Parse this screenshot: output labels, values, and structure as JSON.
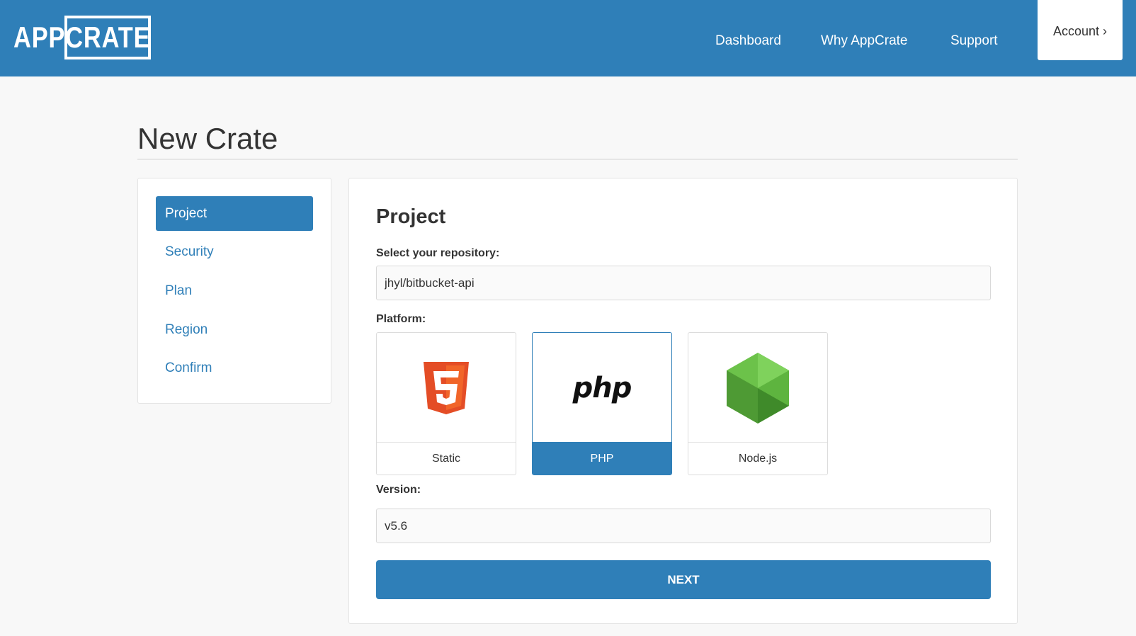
{
  "header": {
    "logo_left": "APP",
    "logo_right": "CRATE",
    "nav": [
      "Dashboard",
      "Why AppCrate",
      "Support"
    ],
    "account_label": "Account ›"
  },
  "page": {
    "title": "New Crate"
  },
  "sidebar": {
    "items": [
      {
        "label": "Project",
        "active": true
      },
      {
        "label": "Security",
        "active": false
      },
      {
        "label": "Plan",
        "active": false
      },
      {
        "label": "Region",
        "active": false
      },
      {
        "label": "Confirm",
        "active": false
      }
    ]
  },
  "form": {
    "section_title": "Project",
    "repository_label": "Select your repository:",
    "repository_value": "jhyl/bitbucket-api",
    "platform_label": "Platform:",
    "platforms": [
      {
        "label": "Static",
        "icon": "html5-icon",
        "selected": false
      },
      {
        "label": "PHP",
        "icon": "php-logo-icon",
        "logo_text": "php",
        "selected": true
      },
      {
        "label": "Node.js",
        "icon": "nodejs-hexagon-icon",
        "selected": false
      }
    ],
    "version_label": "Version:",
    "version_value": "v5.6",
    "next_label": "NEXT"
  },
  "colors": {
    "brand": "#2f7fb8",
    "html5_orange": "#e44d26",
    "node_green": "#6cc24a"
  }
}
